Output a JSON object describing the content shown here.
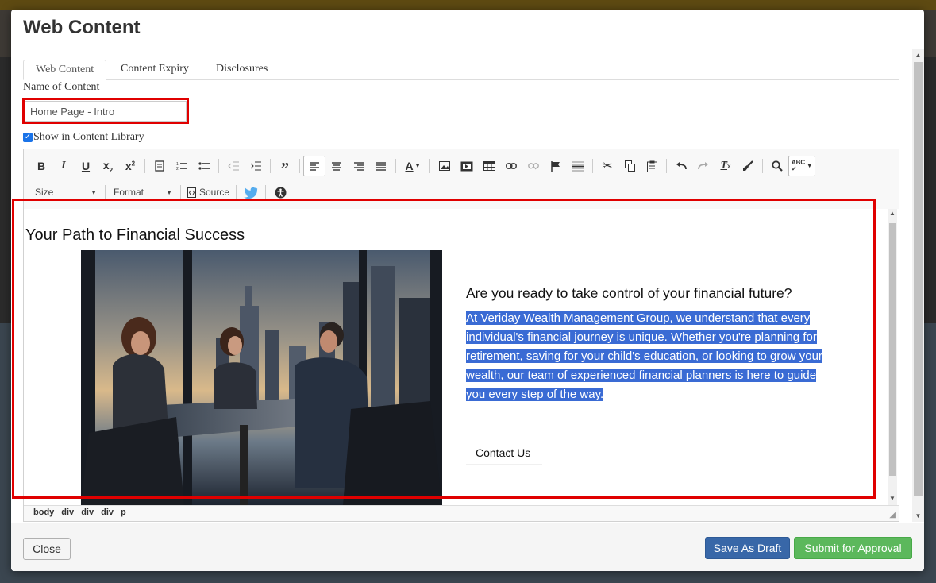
{
  "modal": {
    "title": "Web Content"
  },
  "tabs": [
    {
      "label": "Web Content",
      "active": true
    },
    {
      "label": "Content Expiry",
      "active": false
    },
    {
      "label": "Disclosures",
      "active": false
    }
  ],
  "form": {
    "name_label": "Name of Content",
    "name_value": "Home Page - Intro",
    "show_library_label": "Show in Content Library",
    "show_library_checked": true
  },
  "toolbar": {
    "size_label": "Size",
    "format_label": "Format",
    "source_label": "Source",
    "icons": [
      "bold-icon",
      "italic-icon",
      "underline-icon",
      "subscript-icon",
      "superscript-icon",
      "template-icon",
      "numbered-list-icon",
      "bulleted-list-icon",
      "decrease-indent-icon",
      "increase-indent-icon",
      "blockquote-icon",
      "align-left-icon",
      "align-center-icon",
      "align-right-icon",
      "justify-icon",
      "text-color-icon",
      "image-icon",
      "media-icon",
      "table-icon",
      "link-icon",
      "unlink-icon",
      "anchor-flag-icon",
      "horizontal-rule-icon",
      "cut-icon",
      "copy-icon",
      "paste-icon",
      "undo-icon",
      "redo-icon",
      "remove-format-icon",
      "format-painter-icon",
      "find-icon",
      "spellcheck-icon",
      "source-icon",
      "twitter-icon",
      "accessibility-icon"
    ]
  },
  "content": {
    "heading": "Your Path to Financial Success",
    "question": "Are you ready to take control of your financial future?",
    "paragraph_lines": [
      "At Veriday Wealth Management Group, we understand that every",
      "individual's financial journey is unique. Whether you're planning for",
      "retirement, saving for your child's education, or looking to grow your",
      "wealth, our team of experienced financial planners is here to guide",
      "you every step of the way."
    ],
    "contact_label": "Contact Us"
  },
  "path": [
    "body",
    "div",
    "div",
    "div",
    "p"
  ],
  "footer": {
    "close_label": "Close",
    "draft_label": "Save As Draft",
    "submit_label": "Submit for Approval"
  },
  "colors": {
    "selection": "#3a6bd4",
    "highlight_outline": "#e00000",
    "draft_button": "#3867a8",
    "submit_button": "#5cb85c"
  }
}
